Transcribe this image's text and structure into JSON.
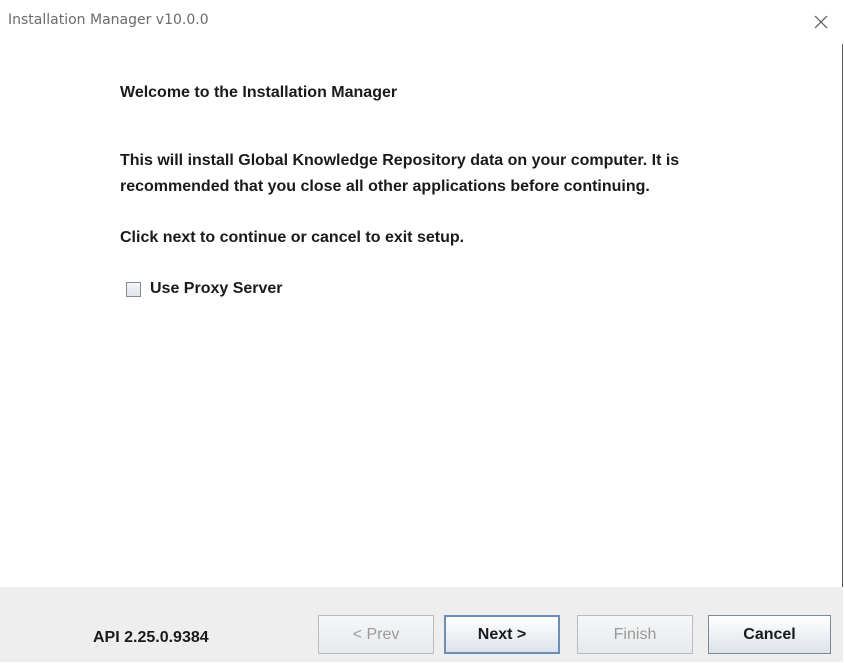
{
  "window": {
    "title": "Installation Manager v10.0.0",
    "close_glyph": "✕"
  },
  "content": {
    "heading": "Welcome to the Installation Manager",
    "paragraph1_line1": "This will install Global Knowledge Repository data on your computer. It is",
    "paragraph1_line2": "recommended that you close all other applications before continuing.",
    "paragraph2": "Click next to continue or cancel to exit setup.",
    "proxy_checkbox": {
      "label": "Use Proxy Server",
      "checked": false
    }
  },
  "footer": {
    "api_version": "API 2.25.0.9384",
    "buttons": {
      "prev": {
        "label": "< Prev",
        "enabled": false
      },
      "next": {
        "label": "Next >",
        "enabled": true
      },
      "finish": {
        "label": "Finish",
        "enabled": false
      },
      "cancel": {
        "label": "Cancel",
        "enabled": true
      }
    }
  },
  "icons": {
    "close": "close-icon",
    "checkbox": "checkbox-icon"
  }
}
